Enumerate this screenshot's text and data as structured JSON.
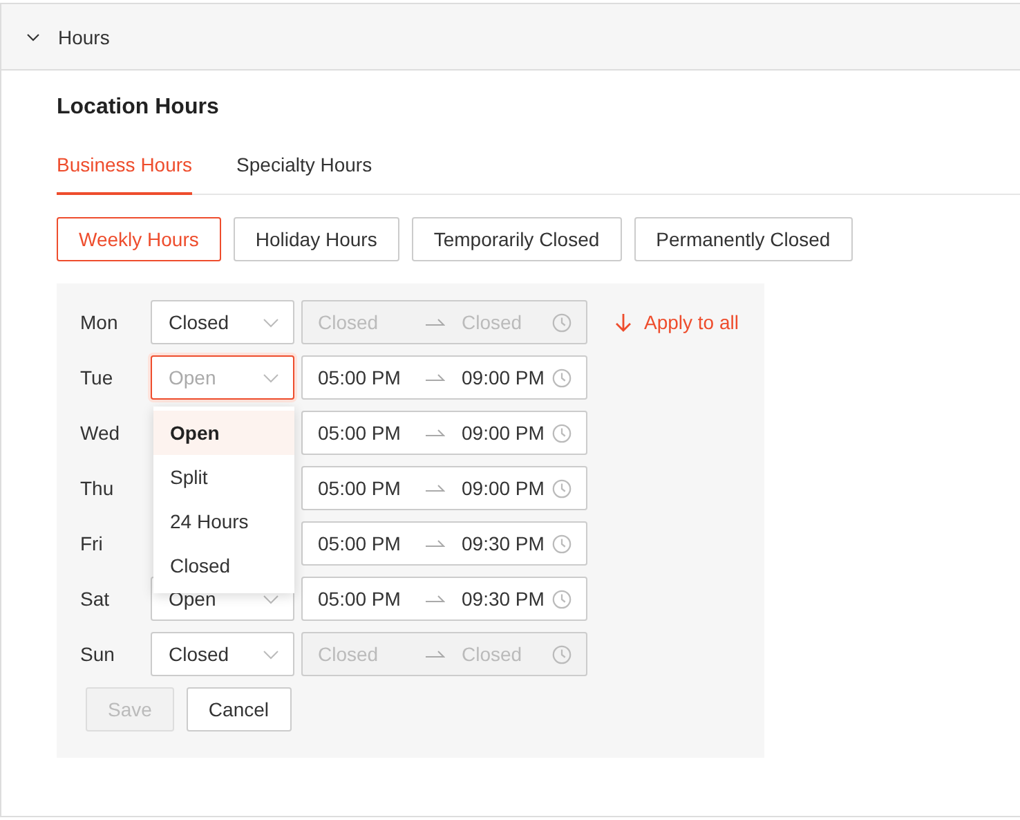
{
  "section": {
    "title": "Hours",
    "expanded": true
  },
  "heading": "Location Hours",
  "tabs": [
    {
      "label": "Business Hours",
      "selected": true
    },
    {
      "label": "Specialty Hours",
      "selected": false
    }
  ],
  "segments": [
    {
      "label": "Weekly Hours",
      "selected": true
    },
    {
      "label": "Holiday Hours",
      "selected": false
    },
    {
      "label": "Temporarily Closed",
      "selected": false
    },
    {
      "label": "Permanently Closed",
      "selected": false
    }
  ],
  "days": [
    {
      "day": "Mon",
      "select": {
        "value": "Closed",
        "focused": false
      },
      "range": {
        "start": "Closed",
        "end": "Closed",
        "disabled": true
      },
      "apply_to_all": "Apply to all"
    },
    {
      "day": "Tue",
      "select": {
        "placeholder": "Open",
        "focused": true
      },
      "range": {
        "start": "05:00 PM",
        "end": "09:00 PM",
        "disabled": false
      }
    },
    {
      "day": "Wed",
      "range": {
        "start": "05:00 PM",
        "end": "09:00 PM",
        "disabled": false
      }
    },
    {
      "day": "Thu",
      "range": {
        "start": "05:00 PM",
        "end": "09:00 PM",
        "disabled": false
      }
    },
    {
      "day": "Fri",
      "range": {
        "start": "05:00 PM",
        "end": "09:30 PM",
        "disabled": false
      }
    },
    {
      "day": "Sat",
      "select": {
        "value": "Open",
        "focused": false
      },
      "range": {
        "start": "05:00 PM",
        "end": "09:30 PM",
        "disabled": false
      }
    },
    {
      "day": "Sun",
      "select": {
        "value": "Closed",
        "focused": false
      },
      "range": {
        "start": "Closed",
        "end": "Closed",
        "disabled": true
      }
    }
  ],
  "dropdown": {
    "options": [
      {
        "label": "Open",
        "selected": true
      },
      {
        "label": "Split",
        "selected": false
      },
      {
        "label": "24 Hours",
        "selected": false
      },
      {
        "label": "Closed",
        "selected": false
      }
    ]
  },
  "buttons": [
    {
      "label": "Save",
      "disabled": true
    },
    {
      "label": "Cancel",
      "disabled": false
    }
  ]
}
